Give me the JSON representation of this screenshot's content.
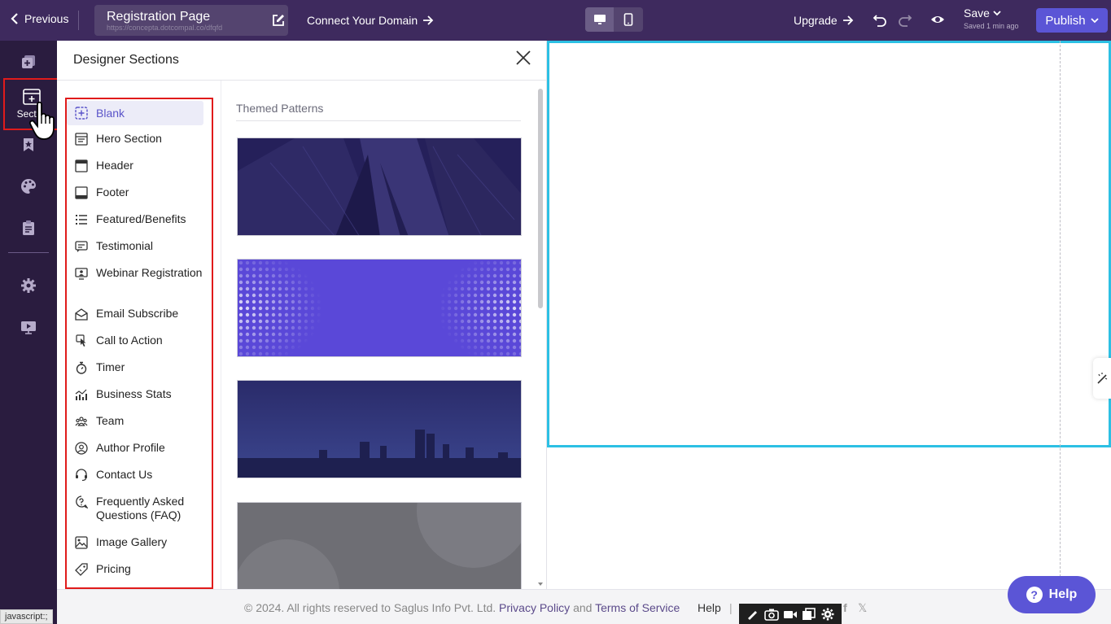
{
  "topbar": {
    "previous_label": "Previous",
    "page_title": "Registration Page",
    "page_url": "https://concepta.dotcompal.co/dfqfd",
    "connect_domain_label": "Connect Your Domain",
    "upgrade_label": "Upgrade",
    "save_label": "Save",
    "saved_status": "Saved 1 min ago",
    "publish_label": "Publish"
  },
  "rail": {
    "active_label": "Secti"
  },
  "panel": {
    "title": "Designer Sections",
    "patterns_heading": "Themed Patterns",
    "sections": [
      {
        "label": "Blank",
        "icon": "plus-square-icon"
      },
      {
        "label": "Hero Section",
        "icon": "hero-layout-icon"
      },
      {
        "label": "Header",
        "icon": "header-layout-icon"
      },
      {
        "label": "Footer",
        "icon": "footer-layout-icon"
      },
      {
        "label": "Featured/Benefits",
        "icon": "list-icon"
      },
      {
        "label": "Testimonial",
        "icon": "testimonial-icon"
      },
      {
        "label": "Webinar Registration",
        "icon": "webinar-icon"
      },
      {
        "label": "Email Subscribe",
        "icon": "envelope-open-icon"
      },
      {
        "label": "Call to Action",
        "icon": "pointer-click-icon"
      },
      {
        "label": "Timer",
        "icon": "stopwatch-icon"
      },
      {
        "label": "Business Stats",
        "icon": "stats-chart-icon"
      },
      {
        "label": "Team",
        "icon": "team-icon"
      },
      {
        "label": "Author Profile",
        "icon": "user-circle-icon"
      },
      {
        "label": "Contact Us",
        "icon": "headset-icon"
      },
      {
        "label": "Frequently Asked Questions (FAQ)",
        "icon": "faq-icon"
      },
      {
        "label": "Image Gallery",
        "icon": "image-icon"
      },
      {
        "label": "Pricing",
        "icon": "price-tag-icon"
      }
    ]
  },
  "footer": {
    "copyright": "©  2024. All rights reserved to Saglus Info Pvt. Ltd.",
    "privacy_label": "Privacy Policy",
    "and_label": "and",
    "terms_label": "Terms of Service",
    "help_label": "Help",
    "separator": "|",
    "fb_label": "f",
    "x_label": "𝕏"
  },
  "help_widget": {
    "label": "Help"
  },
  "status_bar": {
    "url": "javascript:;"
  },
  "colors": {
    "topbar": "#3e2a5e",
    "rail": "#2a1c3f",
    "accent": "#5b55d6",
    "selection": "#2cc0e4",
    "highlight_box": "#e01b1b"
  }
}
